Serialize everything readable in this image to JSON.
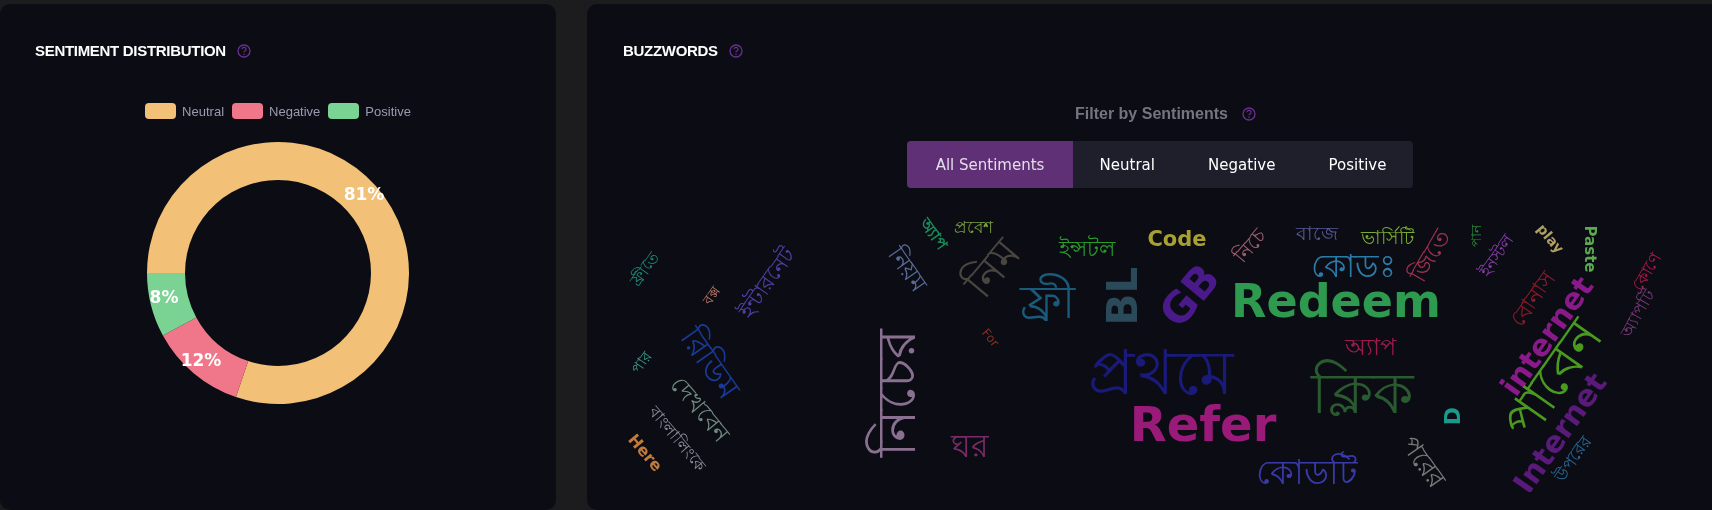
{
  "sentiment_panel": {
    "title": "SENTIMENT DISTRIBUTION",
    "legend": [
      {
        "color": "#f2c077"
      },
      {
        "color": "#f07789"
      },
      {
        "color": "#7bd393"
      }
    ],
    "chart_data": {
      "type": "donut",
      "categories": [
        "Neutral",
        "Negative",
        "Positive"
      ],
      "values": [
        81,
        12,
        8
      ],
      "value_labels": [
        "81%",
        "12%",
        "8%"
      ]
    }
  },
  "buzzwords_panel": {
    "title": "BUZZWORDS",
    "filter_label": "Filter by Sentiments",
    "tabs": [
      {
        "label": "All Sentiments",
        "selected": true
      },
      {
        "label": "Neutral",
        "selected": false
      },
      {
        "label": "Negative",
        "selected": false
      },
      {
        "label": "Positive",
        "selected": false
      }
    ],
    "words": [
      {
        "text": "প্রবেশ",
        "color": "#7aa040"
      },
      {
        "text": "অ্যাপ",
        "color": "#1a8a5a"
      },
      {
        "text": "Code",
        "color": "#a8a030"
      },
      {
        "text": "নিচে",
        "color": "#a06070"
      },
      {
        "text": "বাজে",
        "color": "#5a5a9a"
      },
      {
        "text": "ভার্সিটি",
        "color": "#7aaa30"
      },
      {
        "text": "পান",
        "color": "#2a8a3a"
      },
      {
        "text": "play",
        "color": "#b0a060"
      },
      {
        "text": "ইন্সটল",
        "color": "#2a9a2a"
      },
      {
        "text": "Paste",
        "color": "#5aaa50"
      },
      {
        "text": "জিতে",
        "color": "#a03050"
      },
      {
        "text": "ইনস্টল",
        "color": "#8a3aaa"
      },
      {
        "text": "কোডঃ",
        "color": "#2a7aaa"
      },
      {
        "text": "ফ্রীতে",
        "color": "#1d8a78"
      },
      {
        "text": "নিয়ম",
        "color": "#5a6a9a"
      },
      {
        "text": "নিম",
        "color": "#4a4540"
      },
      {
        "text": "কোণে",
        "color": "#aa1a4a"
      },
      {
        "text": "ইন্টারনেট",
        "color": "#4a40a0"
      },
      {
        "text": "বক্স",
        "color": "#c07a6a"
      },
      {
        "text": "BL",
        "color": "#2a4a5a"
      },
      {
        "text": "GB",
        "color": "#4a1a8a"
      },
      {
        "text": "বোনাস",
        "color": "#8a1a2a"
      },
      {
        "text": "Redeem",
        "color": "#2e9a50"
      },
      {
        "text": "ফ্রী",
        "color": "#1a5a7a"
      },
      {
        "text": "অ্যাপটি",
        "color": "#7a3a7a"
      },
      {
        "text": "internet",
        "color": "#8a1a8a"
      },
      {
        "text": "For",
        "color": "#8a3020"
      },
      {
        "text": "অ্যাপ",
        "color": "#a01a50"
      },
      {
        "text": "পার",
        "color": "#3a9a88"
      },
      {
        "text": "রিডিম",
        "color": "#1a3a9a"
      },
      {
        "text": "প্রথমে",
        "color": "#1a1a7a"
      },
      {
        "text": "পাবেন",
        "color": "#4a9a20"
      },
      {
        "text": "নিচের",
        "color": "#8a7090"
      },
      {
        "text": "ক্লিক",
        "color": "#2a5a30"
      },
      {
        "text": "দেখবেন",
        "color": "#6f8a80"
      },
      {
        "text": "D",
        "color": "#1a9a8a"
      },
      {
        "text": "Refer",
        "color": "#9a1a7a"
      },
      {
        "text": "Internet",
        "color": "#5a1a7a"
      },
      {
        "text": "বাংলালিংকে",
        "color": "#8a8f9a"
      },
      {
        "text": "ঘর",
        "color": "#7a2a6a"
      },
      {
        "text": "Here",
        "color": "#c07a3a"
      },
      {
        "text": "উপরের",
        "color": "#2a6a9a"
      },
      {
        "text": "পরের",
        "color": "#7a7a7a"
      },
      {
        "text": "কোডটি",
        "color": "#3a3aaa"
      }
    ]
  }
}
